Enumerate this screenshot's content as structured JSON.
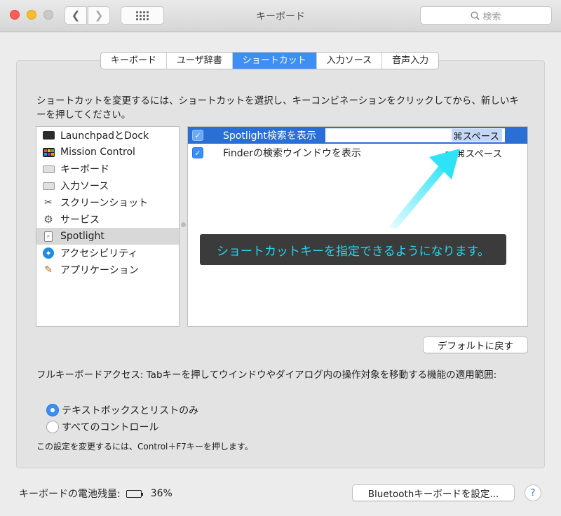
{
  "window": {
    "title": "キーボード"
  },
  "toolbar": {
    "search_placeholder": "検索"
  },
  "tabs": [
    "キーボード",
    "ユーザ辞書",
    "ショートカット",
    "入力ソース",
    "音声入力"
  ],
  "active_tab": "ショートカット",
  "instruction": "ショートカットを変更するには、ショートカットを選択し、キーコンビネーションをクリックしてから、新しいキーを押してください。",
  "categories": [
    {
      "label": "LaunchpadとDock",
      "icon": "launchpad-dock-icon"
    },
    {
      "label": "Mission Control",
      "icon": "mission-control-icon"
    },
    {
      "label": "キーボード",
      "icon": "keyboard-icon"
    },
    {
      "label": "入力ソース",
      "icon": "input-source-icon"
    },
    {
      "label": "スクリーンショット",
      "icon": "screenshot-icon"
    },
    {
      "label": "サービス",
      "icon": "services-gear-icon"
    },
    {
      "label": "Spotlight",
      "icon": "spotlight-icon",
      "selected": true
    },
    {
      "label": "アクセシビリティ",
      "icon": "accessibility-icon"
    },
    {
      "label": "アプリケーション",
      "icon": "applications-icon"
    }
  ],
  "shortcuts": [
    {
      "label": "Spotlight検索を表示",
      "key": "⌘スペース",
      "checked": true,
      "selected": true
    },
    {
      "label": "Finderの検索ウインドウを表示",
      "key": "⌥⌘スペース",
      "checked": true,
      "selected": false
    }
  ],
  "annotation": "ショートカットキーを指定できるようになります。",
  "buttons": {
    "restore_defaults": "デフォルトに戻す",
    "bluetooth_setup": "Bluetoothキーボードを設定...",
    "help": "?"
  },
  "full_keyboard_access": {
    "description": "フルキーボードアクセス: Tabキーを押してウインドウやダイアログ内の操作対象を移動する機能の適用範囲:",
    "options": [
      {
        "label": "テキストボックスとリストのみ",
        "selected": true
      },
      {
        "label": "すべてのコントロール",
        "selected": false
      }
    ],
    "note": "この設定を変更するには、Control＋F7キーを押します。"
  },
  "battery": {
    "label": "キーボードの電池残量:",
    "percent_text": "36%",
    "level": 0.36
  },
  "colors": {
    "accent": "#3a8ef6",
    "selection": "#2a6fd6",
    "annotation_text": "#23d6ee",
    "annotation_arrow": "#2fe3f6"
  }
}
